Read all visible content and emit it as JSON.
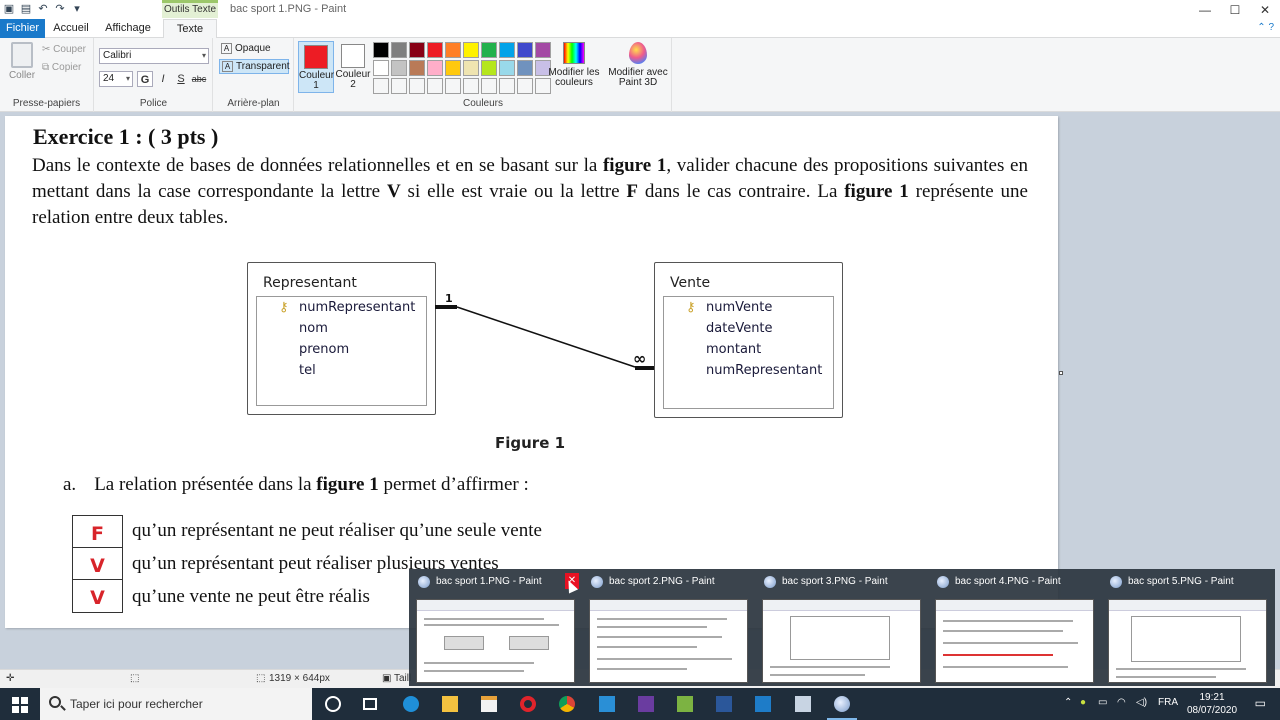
{
  "window": {
    "context_tab": "Outils Texte",
    "doc_title": "bac sport 1.PNG - Paint"
  },
  "tabs": {
    "file": "Fichier",
    "home": "Accueil",
    "view": "Affichage",
    "text": "Texte"
  },
  "ribbon": {
    "clipboard": {
      "paste": "Coller",
      "cut": "Couper",
      "copy": "Copier",
      "label": "Presse-papiers"
    },
    "font": {
      "name": "Calibri",
      "size": "24",
      "bold": "G",
      "italic": "I",
      "underline": "S",
      "strike": "abc",
      "label": "Police"
    },
    "background": {
      "opaque": "Opaque",
      "transparent": "Transparent",
      "label": "Arrière-plan"
    },
    "colors": {
      "color1": "Couleur 1",
      "color2": "Couleur 2",
      "label": "Couleurs",
      "edit": "Modifier les couleurs",
      "paint3d": "Modifier avec Paint 3D",
      "color1_hex": "#ed1c24",
      "color2_hex": "#ffffff",
      "palette": [
        "#000000",
        "#7f7f7f",
        "#880015",
        "#ed1c24",
        "#ff7f27",
        "#fff200",
        "#22b14c",
        "#00a2e8",
        "#3f48cc",
        "#a349a4",
        "#ffffff",
        "#c3c3c3",
        "#b97a57",
        "#ffaec9",
        "#ffc90e",
        "#efe4b0",
        "#b5e61d",
        "#99d9ea",
        "#7092be",
        "#c8bfe7",
        "#f5f6f7",
        "#f5f6f7",
        "#f5f6f7",
        "#f5f6f7",
        "#f5f6f7",
        "#f5f6f7",
        "#f5f6f7",
        "#f5f6f7",
        "#f5f6f7",
        "#f5f6f7"
      ]
    }
  },
  "document": {
    "exercise_title": "Exercice 1 : ( 3 pts )",
    "intro_1": "Dans le contexte de bases de données relationnelles et en se basant sur la ",
    "intro_fig": "figure 1",
    "intro_2": ", valider chacune des propositions suivantes en mettant dans la case correspondante la lettre ",
    "intro_v": "V",
    "intro_3": " si elle est vraie  ou la lettre ",
    "intro_f": "F",
    "intro_4": " dans le cas contraire. La ",
    "intro_fig2": "figure 1",
    "intro_5": " représente une relation entre deux tables.",
    "table_rep": {
      "name": "Representant",
      "fields": [
        "numRepresentant",
        "nom",
        "prenom",
        "tel"
      ]
    },
    "table_vente": {
      "name": "Vente",
      "fields": [
        "numVente",
        "dateVente",
        "montant",
        "numRepresentant"
      ]
    },
    "rel_one": "1",
    "rel_many": "∞",
    "figure_caption": "Figure 1",
    "question_num": "a.",
    "question_text_1": "La relation présentée dans la ",
    "question_fig": "figure 1",
    "question_text_2": " permet d’affirmer :",
    "answers": [
      {
        "mark": "F",
        "text": "qu’un représentant ne peut réaliser qu’une seule vente"
      },
      {
        "mark": "V",
        "text": "qu’un représentant peut réaliser plusieurs ventes"
      },
      {
        "mark": "V",
        "text": "qu’une vente ne peut être réalis"
      }
    ]
  },
  "statusbar": {
    "dimensions": "1319 × 644px",
    "size_label": "Taill"
  },
  "taskbar": {
    "search_placeholder": "Taper ici pour rechercher",
    "lang": "FRA",
    "time": "19:21",
    "date": "08/07/2020",
    "previews": [
      {
        "title": "bac sport 1.PNG - Paint"
      },
      {
        "title": "bac sport 2.PNG - Paint"
      },
      {
        "title": "bac sport 3.PNG - Paint"
      },
      {
        "title": "bac sport 4.PNG - Paint"
      },
      {
        "title": "bac sport 5.PNG - Paint"
      }
    ]
  }
}
